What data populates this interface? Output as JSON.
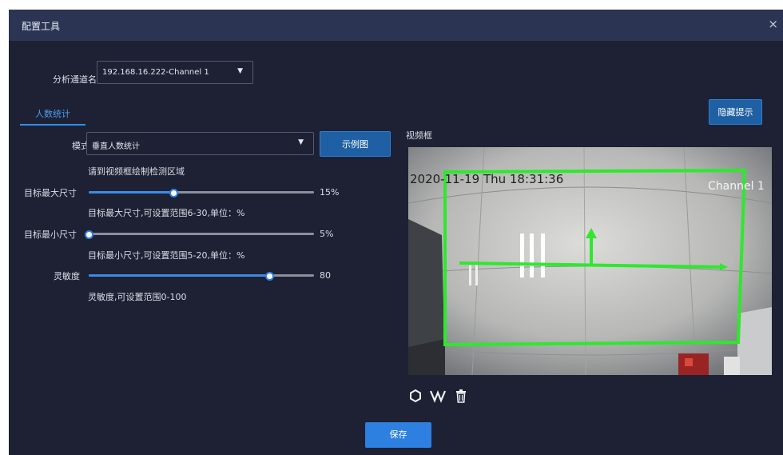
{
  "window": {
    "title": "配置工具",
    "close_glyph": "×"
  },
  "channel": {
    "label": "分析通道名称",
    "selected": "192.168.16.222-Channel 1",
    "caret": "▼"
  },
  "tabs": [
    {
      "label": "人数统计",
      "active": true
    }
  ],
  "buttons": {
    "hide_tips": "隐藏提示",
    "example": "示例图",
    "save": "保存"
  },
  "mode": {
    "label": "模式",
    "selected": "垂直人数统计",
    "caret": "▼",
    "hint": "请到视频框绘制检测区域"
  },
  "sliders": [
    {
      "label": "目标最大尺寸",
      "value": 15,
      "display": "15%",
      "min": 6,
      "max": 30,
      "hint": "目标最大尺寸,可设置范围6-30,单位：%"
    },
    {
      "label": "目标最小尺寸",
      "value": 5,
      "display": "5%",
      "min": 5,
      "max": 20,
      "hint": "目标最小尺寸,可设置范围5-20,单位：%"
    },
    {
      "label": "灵敏度",
      "value": 80,
      "display": "80",
      "min": 0,
      "max": 100,
      "hint": "灵敏度,可设置范围0-100"
    }
  ],
  "video": {
    "label": "视频框",
    "osd_timestamp": "2020-11-19 Thu 18:31:36",
    "osd_channel": "Channel 1",
    "region_color": "#2ee82e"
  },
  "tools": [
    {
      "icon": "hexagon-icon"
    },
    {
      "icon": "polyline-icon"
    },
    {
      "icon": "trash-icon"
    }
  ],
  "colors": {
    "accent": "#2f8ff0",
    "dialog_bg": "#1d2133",
    "titlebar_bg": "#2b3553"
  }
}
